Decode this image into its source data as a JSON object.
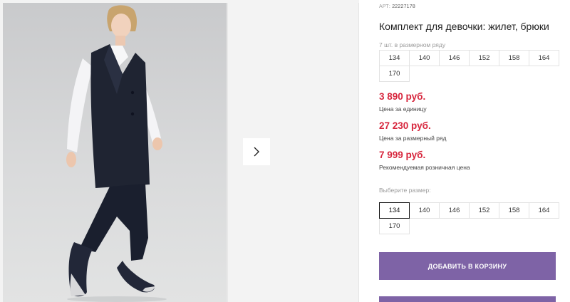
{
  "gallery": {
    "next_icon": "chevron-right-icon"
  },
  "product": {
    "art_label": "АРТ:",
    "art_value": "22227178",
    "title": "Комплект для девочки: жилет, брюки",
    "size_row_label": "7 шт. в размерном ряду",
    "size_row": [
      "134",
      "140",
      "146",
      "152",
      "158",
      "164",
      "170"
    ],
    "prices": [
      {
        "value": "3 890 руб.",
        "note": "Цена за единицу"
      },
      {
        "value": "27 230 руб.",
        "note": "Цена за размерный ряд"
      },
      {
        "value": "7 999 руб.",
        "note": "Рекомендуемая розничная цена"
      }
    ],
    "choose_size_label": "Выберите размер:",
    "sizes": [
      "134",
      "140",
      "146",
      "152",
      "158",
      "164",
      "170"
    ],
    "selected_size": "134",
    "add_to_cart_label": "Добавить в корзину",
    "accent_color": "#7e63a6",
    "price_color": "#d7263d"
  }
}
